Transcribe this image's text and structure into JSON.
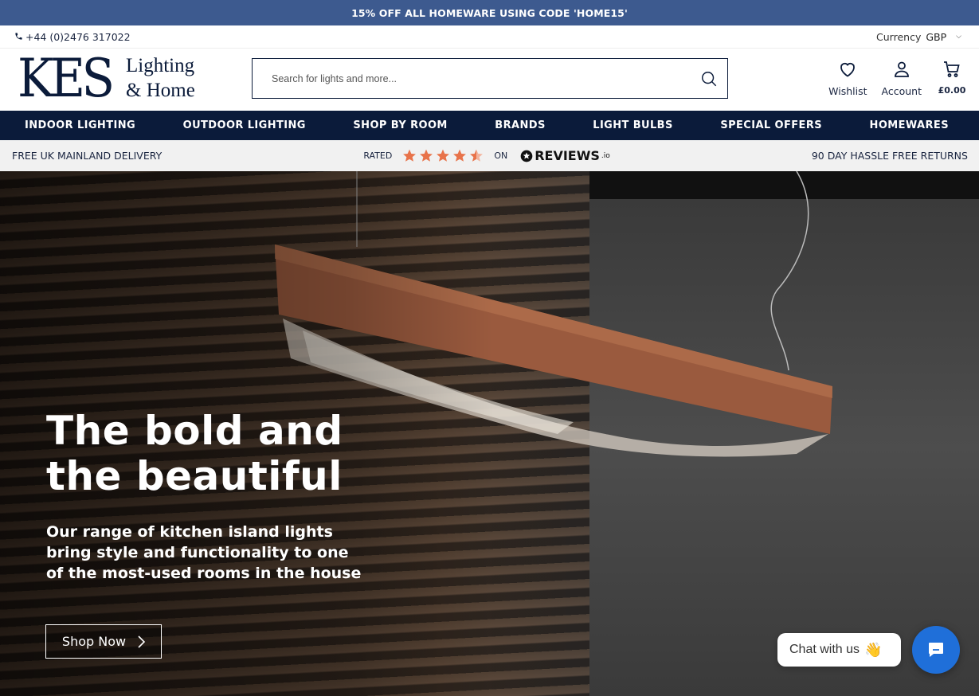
{
  "promo": {
    "text": "15% OFF ALL HOMEWARE USING CODE 'HOME15'"
  },
  "utility": {
    "phone": "+44 (0)2476 317022",
    "currency_label": "Currency",
    "currency_value": "GBP"
  },
  "header": {
    "logo_main": "KES",
    "logo_line1": "Lighting",
    "logo_line2": "& Home",
    "search_placeholder": "Search for lights and more...",
    "wishlist_label": "Wishlist",
    "account_label": "Account",
    "basket_total": "£0.00"
  },
  "nav": {
    "items": [
      {
        "label": "INDOOR LIGHTING"
      },
      {
        "label": "OUTDOOR LIGHTING"
      },
      {
        "label": "SHOP BY ROOM"
      },
      {
        "label": "BRANDS"
      },
      {
        "label": "LIGHT BULBS"
      },
      {
        "label": "SPECIAL OFFERS"
      },
      {
        "label": "HOMEWARES"
      }
    ]
  },
  "usp": {
    "left": "FREE UK MAINLAND DELIVERY",
    "rated": "RATED",
    "stars": 4.5,
    "on": "ON",
    "reviews_brand": "REVIEWS",
    "reviews_suffix": ".io",
    "right": "90 DAY HASSLE FREE RETURNS"
  },
  "hero": {
    "title_line1": "The bold and",
    "title_line2": "the beautiful",
    "text": "Our range of kitchen island lights bring style and functionality to one of the most-used rooms in the house",
    "cta": "Shop Now"
  },
  "chat": {
    "label": "Chat with us",
    "emoji": "👋"
  },
  "colors": {
    "promo_bg": "#3d5a8f",
    "navy": "#0b1b3a",
    "star": "#e8734a",
    "chat_blue": "#1f6fd9"
  }
}
